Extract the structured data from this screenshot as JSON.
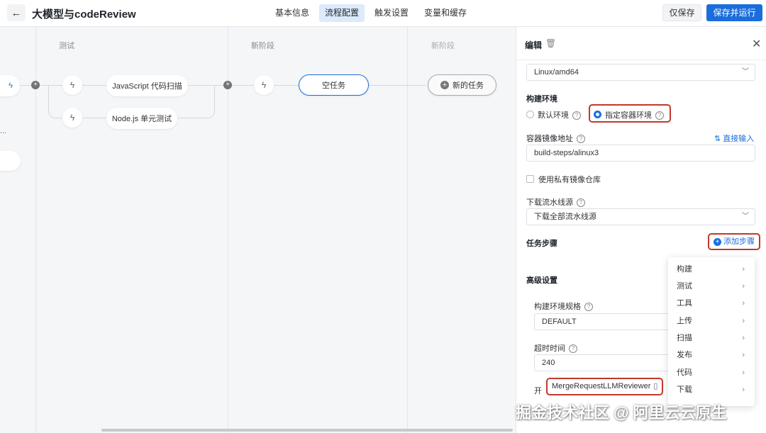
{
  "header": {
    "back_icon": "←",
    "title": "大模型与codeReview",
    "tabs": [
      "基本信息",
      "流程配置",
      "触发设置",
      "变量和缓存"
    ],
    "active_tab": 1,
    "save_label": "仅保存",
    "run_label": "保存并运行"
  },
  "canvas": {
    "stages": [
      {
        "label": "测试"
      },
      {
        "label": "新阶段"
      },
      {
        "label": "新阶段"
      }
    ],
    "tasks": [
      {
        "label": "JavaScript 代码扫描"
      },
      {
        "label": "Node.js 单元测试"
      },
      {
        "label": "空任务"
      },
      {
        "label": "新的任务"
      }
    ],
    "ellipsis": "..."
  },
  "panel": {
    "title": "编辑",
    "platform_value": "Linux/amd64",
    "build_env_label": "构建环境",
    "env_options": [
      "默认环境",
      "指定容器环境"
    ],
    "selected_env": 1,
    "image_label": "容器镜像地址",
    "direct_input_label": "直接输入",
    "image_value": "build-steps/alinux3",
    "private_repo_label": "使用私有镜像仓库",
    "download_label": "下载流水线源",
    "download_value": "下载全部流水线源",
    "steps_label": "任务步骤",
    "add_step_label": "添加步骤",
    "advanced_label": "高级设置",
    "spec_label": "构建环境规格",
    "spec_value": "DEFAULT",
    "timeout_label": "超时时间",
    "timeout_value": "240",
    "start_label_partial": "开"
  },
  "menu": {
    "items": [
      "构建",
      "测试",
      "工具",
      "上传",
      "扫描",
      "发布",
      "代码",
      "下载"
    ]
  },
  "tooltip": {
    "text": "MergeRequestLLMReviewer"
  },
  "watermark": "掘金技术社区 @ 阿里云云原生"
}
